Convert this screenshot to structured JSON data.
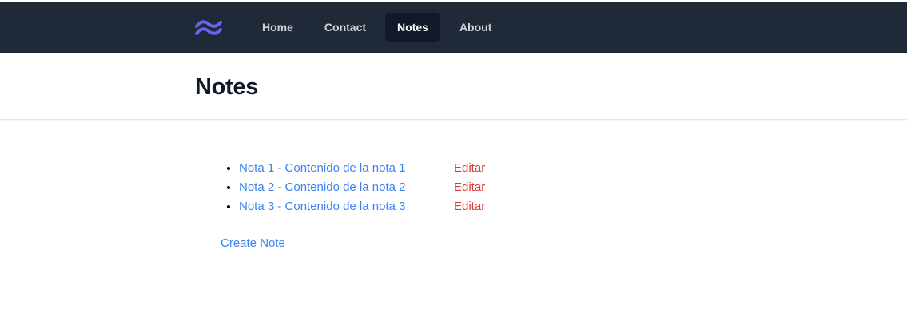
{
  "nav": {
    "logo_icon": "tailwind-wave-icon",
    "links": [
      {
        "label": "Home",
        "active": false
      },
      {
        "label": "Contact",
        "active": false
      },
      {
        "label": "Notes",
        "active": true
      },
      {
        "label": "About",
        "active": false
      }
    ]
  },
  "header": {
    "title": "Notes"
  },
  "notes": [
    {
      "label": "Nota 1 - Contenido de la nota 1",
      "edit": "Editar"
    },
    {
      "label": "Nota 2 - Contenido de la nota 2",
      "edit": "Editar"
    },
    {
      "label": "Nota 3 - Contenido de la nota 3",
      "edit": "Editar"
    }
  ],
  "actions": {
    "create_label": "Create Note"
  },
  "colors": {
    "navbar_bg": "#1f2937",
    "active_link_bg": "#111827",
    "link_blue": "#3b82f6",
    "edit_red": "#dc3b35",
    "logo_blue": "#6366f1"
  }
}
